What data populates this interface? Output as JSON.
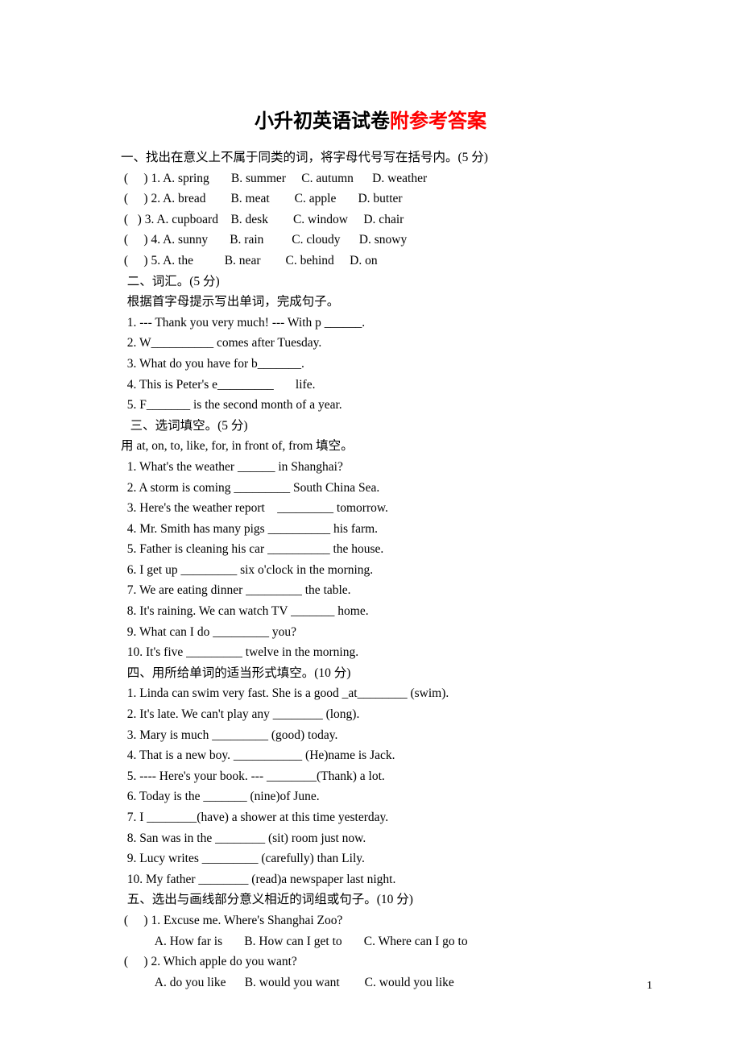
{
  "title_main": "小升初英语试卷",
  "title_red": "附参考答案",
  "lines": [
    "一、找出在意义上不属于同类的词，将字母代号写在括号内。(5 分)",
    " (     ) 1. A. spring       B. summer     C. autumn      D. weather",
    " (     ) 2. A. bread        B. meat        C. apple       D. butter",
    " (   ) 3. A. cupboard    B. desk        C. window     D. chair",
    " (     ) 4. A. sunny       B. rain         C. cloudy      D. snowy",
    " (     ) 5. A. the          B. near        C. behind     D. on",
    "  二、词汇。(5 分)",
    "  根据首字母提示写出单词，完成句子。",
    "  1. --- Thank you very much! --- With p ______.",
    "  2. W__________ comes after Tuesday.",
    "  3. What do you have for b_______.",
    "  4. This is Peter's e_________       life.",
    "  5. F_______ is the second month of a year.",
    "   三、选词填空。(5 分)",
    "用 at, on, to, like, for, in front of, from 填空。",
    "  1. What's the weather ______ in Shanghai?",
    "  2. A storm is coming _________ South China Sea.",
    "  3. Here's the weather report    _________ tomorrow.",
    "  4. Mr. Smith has many pigs __________ his farm.",
    "  5. Father is cleaning his car __________ the house.",
    "  6. I get up _________ six o'clock in the morning.",
    "  7. We are eating dinner _________ the table.",
    "  8. It's raining. We can watch TV _______ home.",
    "  9. What can I do _________ you?",
    "  10. It's five _________ twelve in the morning.",
    "  四、用所给单词的适当形式填空。(10 分)",
    "  1. Linda can swim very fast. She is a good _at________ (swim).",
    "  2. It's late. We can't play any ________ (long).",
    "  3. Mary is much _________ (good) today.",
    "  4. That is a new boy. ___________ (He)name is Jack.",
    "  5. ---- Here's your book. --- ________(Thank) a lot.",
    "  6. Today is the _______ (nine)of June.",
    "  7. I ________(have) a shower at this time yesterday.",
    "  8. San was in the ________ (sit) room just now.",
    "  9. Lucy writes _________ (carefully) than Lily.",
    "  10. My father ________ (read)a newspaper last night.",
    "  五、选出与画线部分意义相近的词组或句子。(10 分)",
    " (     ) 1. Excuse me. Where's Shanghai Zoo?",
    "           A. How far is       B. How can I get to       C. Where can I go to",
    " (     ) 2. Which apple do you want?",
    "           A. do you like      B. would you want        C. would you like"
  ],
  "page_number": "1"
}
